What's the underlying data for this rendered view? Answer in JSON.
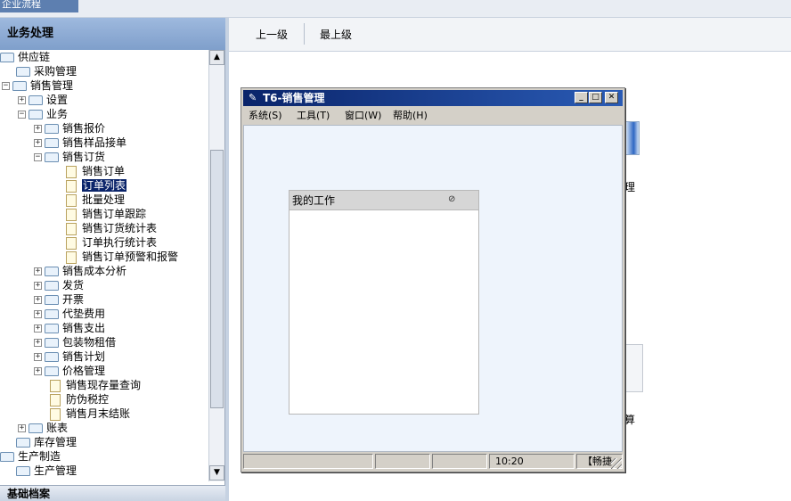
{
  "top_tab": {
    "label": "企业流程"
  },
  "left_panel": {
    "header": "业务处理",
    "footer": "基础档案",
    "tree": [
      {
        "label": "供应链"
      },
      {
        "label": "采购管理"
      },
      {
        "label": "销售管理"
      },
      {
        "label": "设置"
      },
      {
        "label": "业务"
      },
      {
        "label": "销售报价"
      },
      {
        "label": "销售样品接单"
      },
      {
        "label": "销售订货"
      },
      {
        "label": "销售订单"
      },
      {
        "label": "订单列表"
      },
      {
        "label": "批量处理"
      },
      {
        "label": "销售订单跟踪"
      },
      {
        "label": "销售订货统计表"
      },
      {
        "label": "订单执行统计表"
      },
      {
        "label": "销售订单预警和报警"
      },
      {
        "label": "销售成本分析"
      },
      {
        "label": "发货"
      },
      {
        "label": "开票"
      },
      {
        "label": "代垫费用"
      },
      {
        "label": "销售支出"
      },
      {
        "label": "包装物租借"
      },
      {
        "label": "销售计划"
      },
      {
        "label": "价格管理"
      },
      {
        "label": "销售现存量查询"
      },
      {
        "label": "防伪税控"
      },
      {
        "label": "销售月末结账"
      },
      {
        "label": "账表"
      },
      {
        "label": "库存管理"
      },
      {
        "label": "生产制造"
      },
      {
        "label": "生产管理"
      }
    ],
    "selected_item": "订单列表"
  },
  "right_nav": {
    "up_label": "上一级",
    "top_label": "最上级"
  },
  "background_text": {
    "item1": "理",
    "item2": "算"
  },
  "dialog": {
    "title": "T6-销售管理",
    "menu": [
      "系统(S)",
      "工具(T)",
      "窗口(W)",
      "帮助(H)"
    ],
    "my_work_title": "我的工作",
    "status": {
      "time": "10:20",
      "right": "【畅捷"
    }
  },
  "colors": {
    "selection": "#0a246a",
    "titlebar": "#0a246a",
    "client_bg": "#eef4fc"
  }
}
